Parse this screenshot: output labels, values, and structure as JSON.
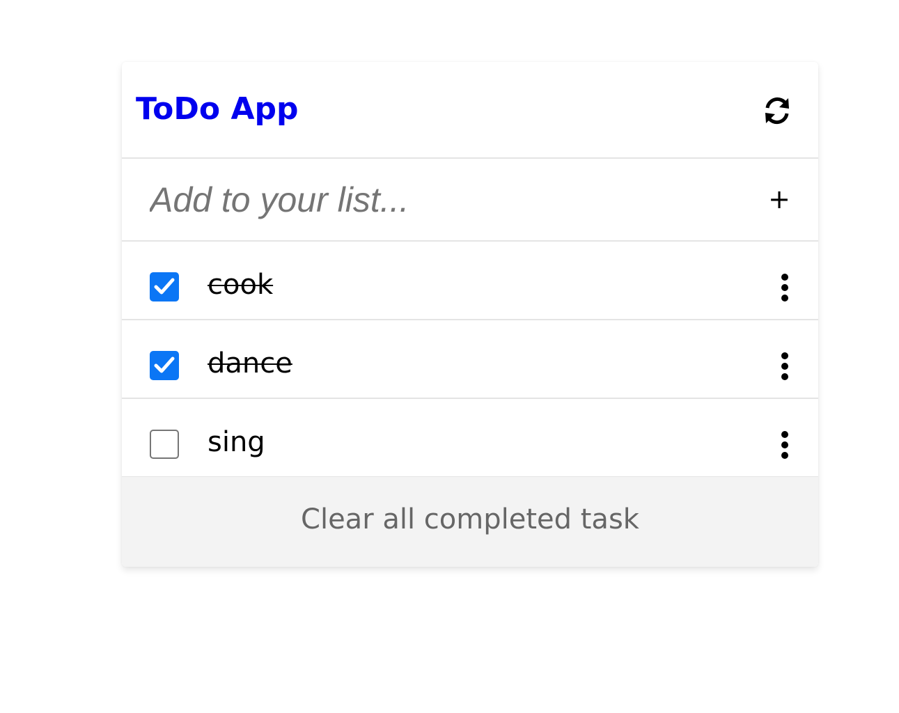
{
  "app": {
    "title": "ToDo App",
    "refresh_icon": "refresh-icon",
    "title_color": "#0000ee"
  },
  "add": {
    "value": "",
    "placeholder": "Add to your list...",
    "button_label": "+"
  },
  "tasks": [
    {
      "label": "cook",
      "completed": true
    },
    {
      "label": "dance",
      "completed": true
    },
    {
      "label": "sing",
      "completed": false
    }
  ],
  "footer": {
    "clear_label": "Clear all completed task"
  },
  "colors": {
    "accent": "#0b76f5",
    "footer_bg": "#f3f3f3",
    "divider": "#e4e4e4"
  }
}
